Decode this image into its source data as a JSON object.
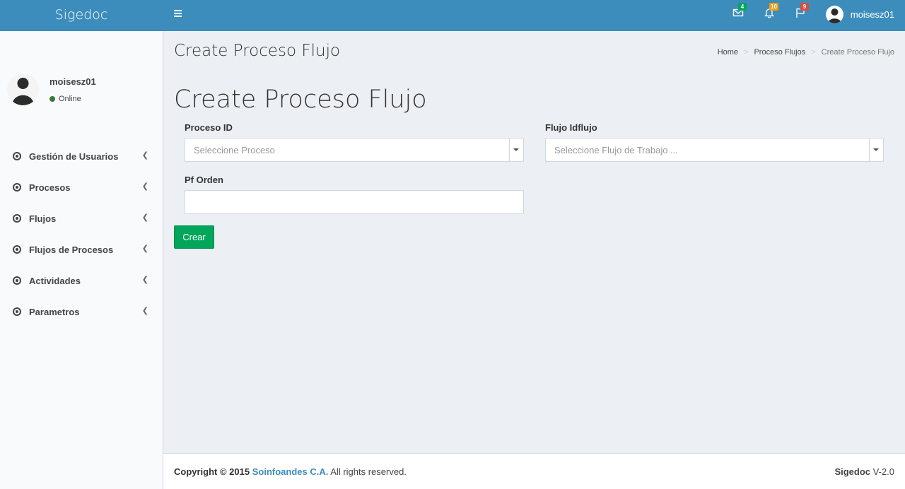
{
  "header": {
    "logo": "Sigedoc",
    "mail_badge": "4",
    "bell_badge": "10",
    "flag_badge": "9",
    "user_name": "moisesz01"
  },
  "sidebar": {
    "user_name": "moisesz01",
    "status": "Online",
    "items": [
      {
        "label": "Gestión de Usuarios"
      },
      {
        "label": "Procesos"
      },
      {
        "label": "Flujos"
      },
      {
        "label": "Flujos de Procesos"
      },
      {
        "label": "Actividades"
      },
      {
        "label": "Parametros"
      }
    ]
  },
  "content": {
    "page_title": "Create Proceso Flujo",
    "breadcrumb": {
      "home": "Home",
      "section": "Proceso Flujos",
      "current": "Create Proceso Flujo"
    },
    "form_title": "Create Proceso Flujo",
    "fields": {
      "proceso_label": "Proceso ID",
      "proceso_placeholder": "Seleccione Proceso",
      "flujo_label": "Flujo Idflujo",
      "flujo_placeholder": "Seleccione Flujo de Trabajo ...",
      "orden_label": "Pf Orden",
      "orden_value": ""
    },
    "submit_label": "Crear"
  },
  "footer": {
    "copyright_prefix": "Copyright © 2015",
    "company": "Soinfoandes C.A.",
    "rights": "All rights reserved.",
    "app_name": "Sigedoc",
    "version": "V-2.0"
  },
  "colors": {
    "brand": "#3c8dbc",
    "success": "#00a65a",
    "badge_green": "#00a65a",
    "badge_orange": "#f39c12",
    "badge_red": "#dd4b39"
  }
}
